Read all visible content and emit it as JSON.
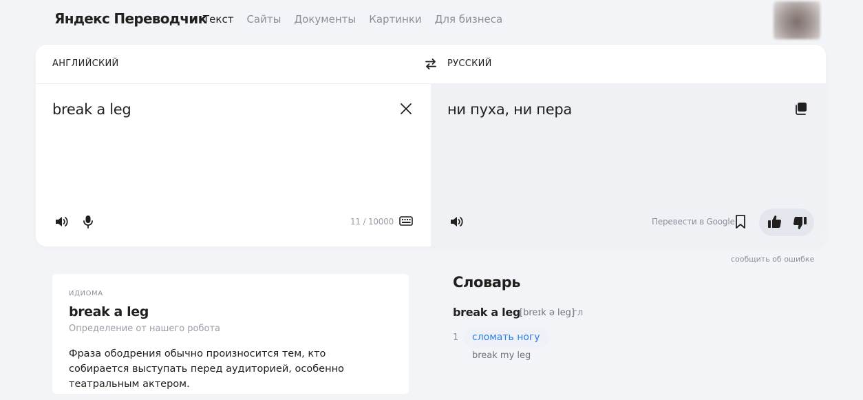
{
  "header": {
    "logo": "Яндекс Переводчик",
    "nav": [
      "Текст",
      "Сайты",
      "Документы",
      "Картинки",
      "Для бизнеса"
    ],
    "active_nav": "Текст"
  },
  "translator": {
    "source_language": "АНГЛИЙСКИЙ",
    "target_language": "РУССКИЙ",
    "source_text": "break a leg",
    "translated_text": "ни пуха, ни пера",
    "char_counter": "11 / 10000",
    "google_link": "Перевести в Google",
    "report_error": "сообщить об ошибке"
  },
  "idiom": {
    "tag": "ИДИОМА",
    "title": "break a leg",
    "subtitle": "Определение от нашего робота",
    "description": "Фраза ободрения обычно произносится тем, кто собирается выступать перед аудиторией, особенно театральным актером."
  },
  "dictionary": {
    "title": "Словарь",
    "word": "break a leg",
    "transcription": "[breɪk ə leg]",
    "part_of_speech": "гл",
    "entries": [
      {
        "number": "1",
        "translation": "сломать ногу",
        "example": "break my leg"
      }
    ]
  },
  "icons": {
    "swap": "swap-arrows-icon",
    "clear": "close-icon",
    "copy": "copy-icon",
    "speaker": "speaker-icon",
    "microphone": "microphone-icon",
    "keyboard": "keyboard-icon",
    "bookmark": "bookmark-icon",
    "like": "thumbs-up-icon",
    "dislike": "thumbs-down-icon"
  },
  "colors": {
    "background": "#f3f4f7",
    "target_pane": "#eff1f5",
    "link_blue": "#2d7de0",
    "text": "#21201f",
    "muted": "#8b8e99"
  }
}
